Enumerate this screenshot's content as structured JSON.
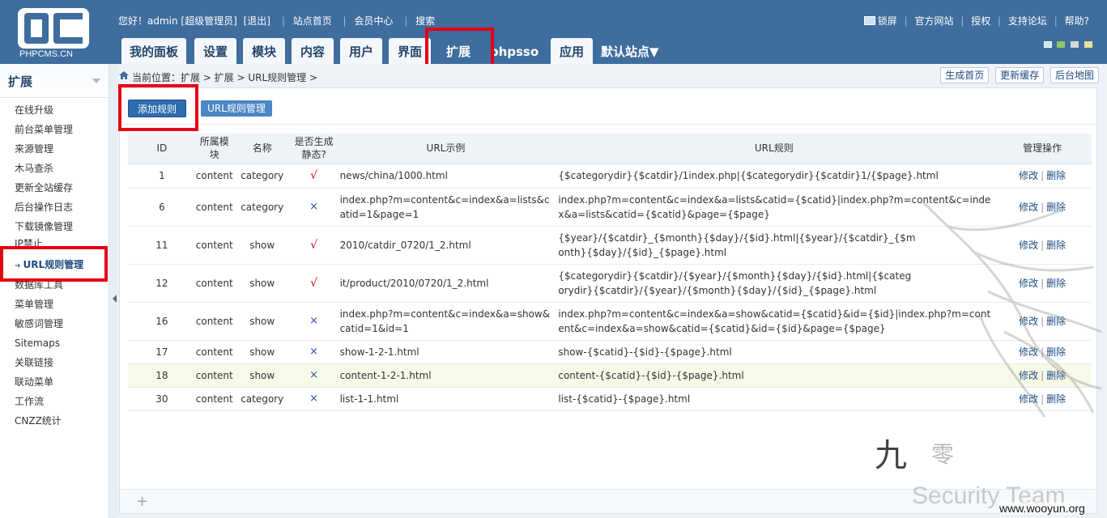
{
  "logo": {
    "text": "PHPCMS.CN"
  },
  "topbar": {
    "greeting": "您好！admin [超级管理员]",
    "logout": "[退出]",
    "site_home": "站点首页",
    "member_center": "会员中心",
    "search": "搜索"
  },
  "topright": {
    "lock": "锁屏",
    "official": "官方网站",
    "license": "授权",
    "forum": "支持论坛",
    "help": "帮助?"
  },
  "nav": {
    "tabs": [
      {
        "label": "我的面板"
      },
      {
        "label": "设置"
      },
      {
        "label": "模块"
      },
      {
        "label": "内容"
      },
      {
        "label": "用户"
      },
      {
        "label": "界面"
      },
      {
        "label": "扩展"
      },
      {
        "label": "phpsso"
      },
      {
        "label": "应用"
      }
    ],
    "site_select": "默认站点▼",
    "active": "扩展"
  },
  "sidebar": {
    "title": "扩展",
    "items": [
      {
        "label": "在线升级"
      },
      {
        "label": "前台菜单管理"
      },
      {
        "label": "来源管理"
      },
      {
        "label": "木马查杀"
      },
      {
        "label": "更新全站缓存"
      },
      {
        "label": "后台操作日志"
      },
      {
        "label": "下载镜像管理"
      },
      {
        "label": "IP禁止"
      },
      {
        "label": "URL规则管理"
      },
      {
        "label": "数据库工具"
      },
      {
        "label": "菜单管理"
      },
      {
        "label": "敏感词管理"
      },
      {
        "label": "Sitemaps"
      },
      {
        "label": "关联链接"
      },
      {
        "label": "联动菜单"
      },
      {
        "label": "工作流"
      },
      {
        "label": "CNZZ统计"
      }
    ]
  },
  "breadcrumb": {
    "text": "当前位置：扩展 > 扩展 > URL规则管理 >"
  },
  "crumb_buttons": {
    "gen_home": "生成首页",
    "update_cache": "更新缓存",
    "admin_map": "后台地图"
  },
  "subbar": {
    "add_rule": "添加规则",
    "rule_manage": "URL规则管理"
  },
  "table": {
    "headers": {
      "id": "ID",
      "module": "所属模块",
      "name": "名称",
      "static": "是否生成静态?",
      "example": "URL示例",
      "rule": "URL规则",
      "ops": "管理操作"
    },
    "rows": [
      {
        "id": "1",
        "module": "content",
        "name": "category",
        "static": "√",
        "example": "news/china/1000.html",
        "rule": "{$categorydir}{$catdir}/1index.php|{$categorydir}{$catdir}1/{$page}.html"
      },
      {
        "id": "6",
        "module": "content",
        "name": "category",
        "static": "×",
        "example": "index.php?m=content&c=index&a=lists&catid=1&page=1",
        "rule": "index.php?m=content&c=index&a=lists&catid={$catid}|index.php?m=content&c=index&a=lists&catid={$catid}&page={$page}"
      },
      {
        "id": "11",
        "module": "content",
        "name": "show",
        "static": "√",
        "example": "2010/catdir_0720/1_2.html",
        "rule": "{$year}/{$catdir}_{$month}{$day}/{$id}.html|{$year}/{$catdir}_{$month}{$day}/{$id}_{$page}.html"
      },
      {
        "id": "12",
        "module": "content",
        "name": "show",
        "static": "√",
        "example": "it/product/2010/0720/1_2.html",
        "rule": "{$categorydir}{$catdir}/{$year}/{$month}{$day}/{$id}.html|{$categorydir}{$catdir}/{$year}/{$month}{$day}/{$id}_{$page}.html"
      },
      {
        "id": "16",
        "module": "content",
        "name": "show",
        "static": "×",
        "example": "index.php?m=content&c=index&a=show&catid=1&id=1",
        "rule": "index.php?m=content&c=index&a=show&catid={$catid}&id={$id}|index.php?m=content&c=index&a=show&catid={$catid}&id={$id}&page={$page}"
      },
      {
        "id": "17",
        "module": "content",
        "name": "show",
        "static": "×",
        "example": "show-1-2-1.html",
        "rule": "show-{$catid}-{$id}-{$page}.html"
      },
      {
        "id": "18",
        "module": "content",
        "name": "show",
        "static": "×",
        "example": "content-1-2-1.html",
        "rule": "content-{$catid}-{$id}-{$page}.html"
      },
      {
        "id": "30",
        "module": "content",
        "name": "category",
        "static": "×",
        "example": "list-1-1.html",
        "rule": "list-{$catid}-{$page}.html"
      }
    ],
    "op_edit": "修改",
    "op_delete": "删除"
  },
  "footer": {
    "plus": "+"
  },
  "watermark": {
    "sig1": "九",
    "sig2": "零",
    "team": "Security Team",
    "site": "www.wooyun.org"
  },
  "colors": {
    "header": "#3e6d9e",
    "highlight": "#e50012",
    "check": "#e00000",
    "cross": "#2a52b8"
  }
}
